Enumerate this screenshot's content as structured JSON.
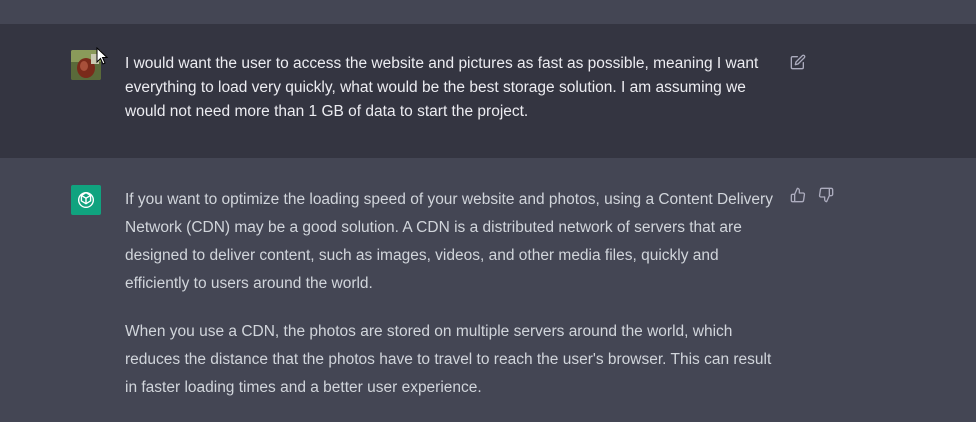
{
  "conversation": {
    "user_message": {
      "text": "I would want the user to access the website and pictures as fast as possible, meaning I want everything to load very quickly, what would be the best storage solution. I am assuming we would not need more than 1 GB of data to start the project.",
      "edit_icon": "edit-icon"
    },
    "assistant_message": {
      "paragraphs": [
        "If you want to optimize the loading speed of your website and photos, using a Content Delivery Network (CDN) may be a good solution. A CDN is a distributed network of servers that are designed to deliver content, such as images, videos, and other media files, quickly and efficiently to users around the world.",
        "When you use a CDN, the photos are stored on multiple servers around the world, which reduces the distance that the photos have to travel to reach the user's browser. This can result in faster loading times and a better user experience."
      ],
      "feedback_icons": [
        "thumbs-up-icon",
        "thumbs-down-icon"
      ]
    }
  },
  "colors": {
    "user_bg": "#343541",
    "assistant_bg": "#444654",
    "accent": "#10a37f",
    "text": "#ececf1"
  }
}
